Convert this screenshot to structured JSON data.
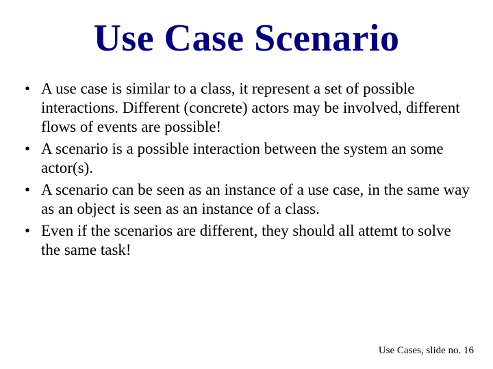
{
  "title": "Use Case Scenario",
  "bullets": [
    "A use case is similar to a class, it represent a set of possible interactions. Different (concrete) actors may be involved, different flows of events are possible!",
    "A scenario is a possible interaction between the system an some actor(s).",
    "A scenario can be seen as an instance of a use case, in the same way as an object is seen as an instance of a class.",
    "Even if the scenarios are different, they should all attemt to solve the same task!"
  ],
  "footer": "Use Cases, slide no. 16"
}
